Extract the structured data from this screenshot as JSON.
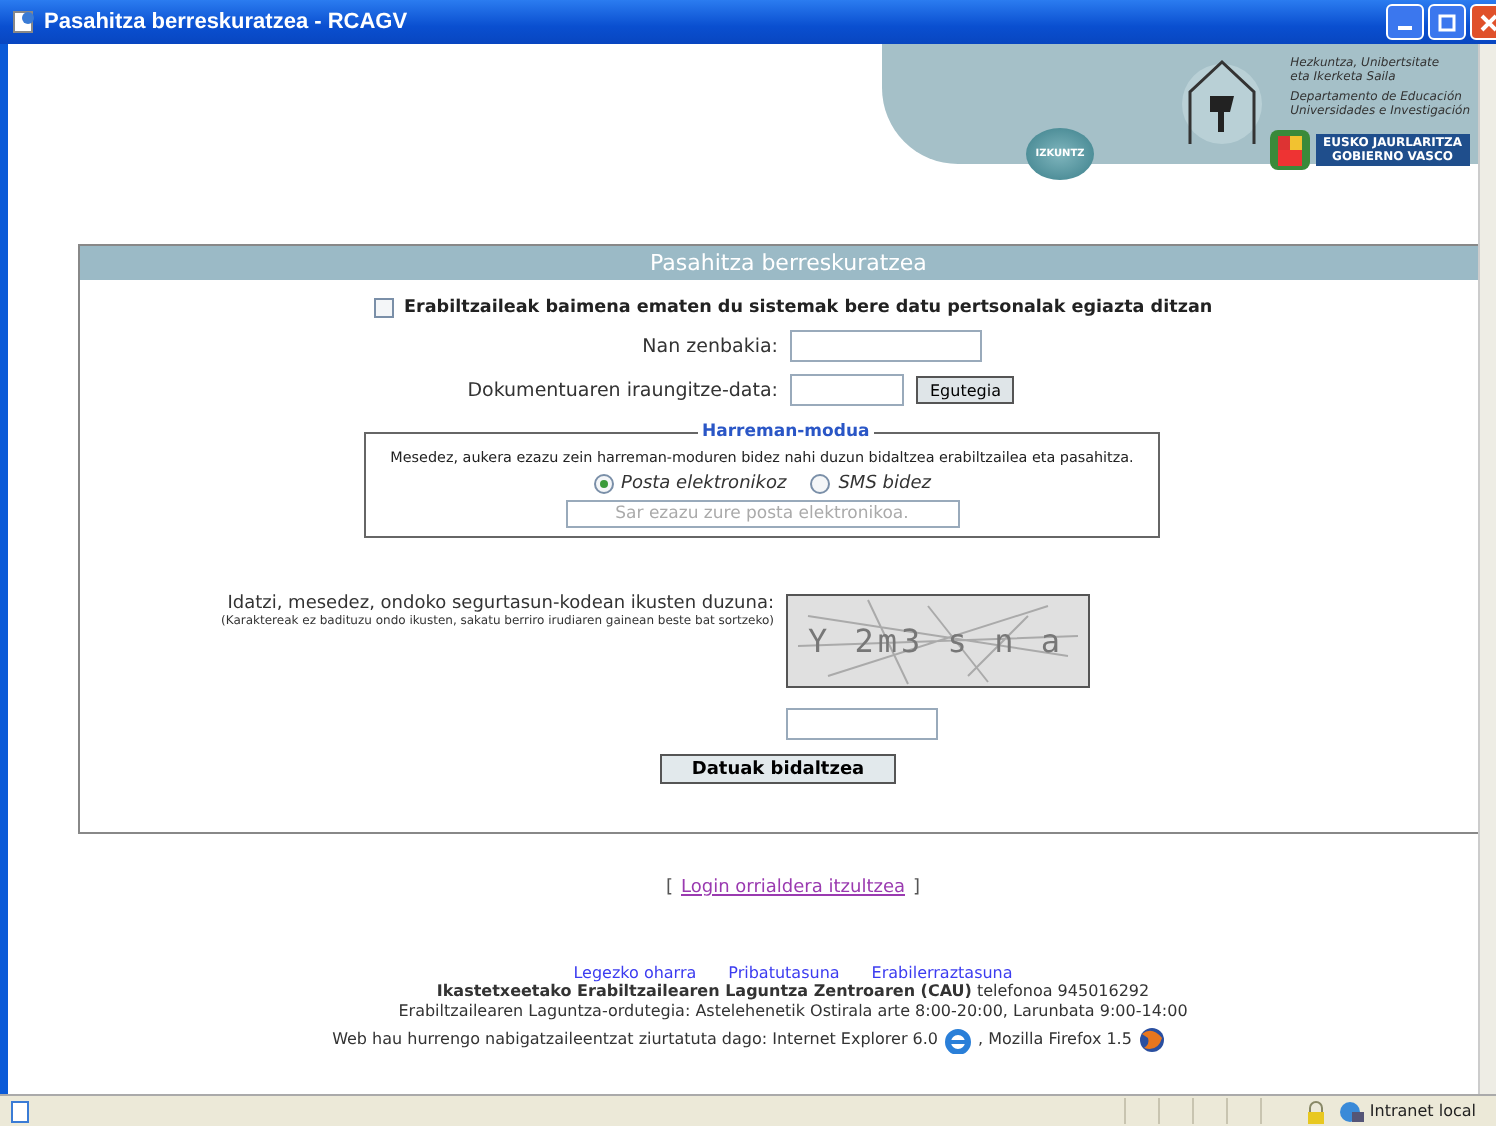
{
  "window": {
    "title": "Pasahitza berreskuratzea - RCAGV"
  },
  "banner": {
    "department": [
      "Hezkuntza, Unibertsitate",
      "eta Ikerketa Saila"
    ],
    "department_es": [
      "Departamento de Educación",
      "Universidades e Investigación"
    ],
    "round_button": "IZKUNTZ",
    "government": [
      "EUSKO JAURLARITZA",
      "GOBIERNO VASCO"
    ]
  },
  "form": {
    "title": "Pasahitza berreskuratzea",
    "consent": {
      "label": "Erabiltzaileak baimena ematen du sistemak bere datu pertsonalak egiazta ditzan",
      "checked": false
    },
    "fields": [
      {
        "kind": "text",
        "label": "Nan zenbakia:"
      },
      {
        "kind": "date",
        "label": "Dokumentuaren iraungitze-data:",
        "button": "Egutegia"
      }
    ],
    "contact": {
      "legend": "Harreman-modua",
      "prompt": "Mesedez, aukera ezazu zein harreman-moduren bidez nahi duzun bidaltzea erabiltzailea eta pasahitza.",
      "options": [
        {
          "label": "Posta elektronikoz",
          "selected": true
        },
        {
          "label": "SMS bidez",
          "selected": false
        }
      ],
      "placeholder": "Sar ezazu zure posta elektronikoa."
    },
    "captcha": {
      "label": "Idatzi, mesedez, ondoko segurtasun-kodean ikusten duzuna:",
      "hint": "(Karaktereak ez badituzu ondo ikusten, sakatu berriro irudiaren gainean beste bat sortzeko)",
      "code": "Y 2m3 s n a"
    },
    "submit": "Datuak bidaltzea"
  },
  "back_link": {
    "open": "[",
    "label": "Login orrialdera itzultzea",
    "close": "]"
  },
  "footer": {
    "links": [
      "Legezko oharra",
      "Pribatutasuna",
      "Erabilerraztasuna"
    ],
    "contact": "**Ikastetxeetako Erabiltzailearen Laguntza Zentroaren (CAU)** telefonoa 945016292",
    "hours": "Erabiltzailearen Laguntza-ordutegia: Astelehenetik Ostirala arte 8:00-20:00, Larunbata 9:00-14:00",
    "browsers": [
      "Web hau hurrengo nabigatzaileentzat ziurtatuta dago:  Internet Explorer 6.0",
      ", Mozilla Firefox 1.5"
    ]
  },
  "status_bar": {
    "zone": "Intranet local"
  }
}
